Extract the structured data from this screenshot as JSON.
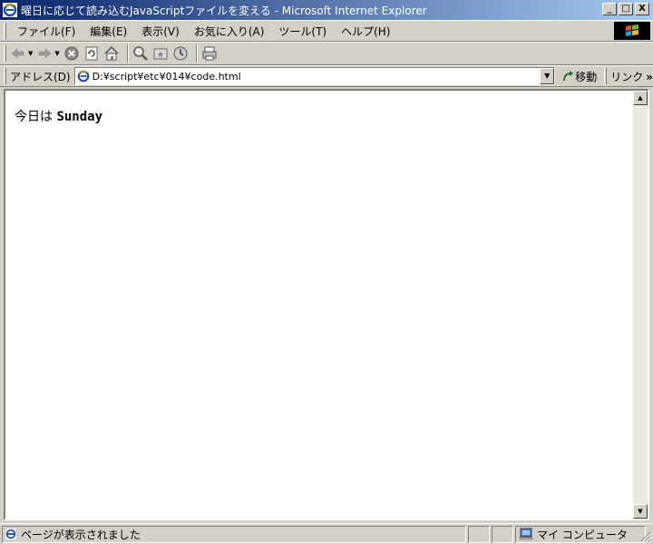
{
  "window": {
    "title": "曜日に応じて読み込むJavaScriptファイルを変える - Microsoft Internet Explorer",
    "minimize": "_",
    "maximize": "□",
    "close": "X"
  },
  "menu": {
    "items": [
      "ファイル(F)",
      "編集(E)",
      "表示(V)",
      "お気に入り(A)",
      "ツール(T)",
      "ヘルプ(H)"
    ]
  },
  "toolbar": {
    "icons": [
      "back-icon",
      "forward-icon",
      "stop-icon",
      "refresh-icon",
      "home-icon",
      "search-icon",
      "favorites-icon",
      "history-icon",
      "print-icon"
    ]
  },
  "address": {
    "label": "アドレス(D)",
    "url": "D:¥script¥etc¥014¥code.html",
    "go_label": "移動",
    "links_label": "リンク",
    "links_chevron": "»"
  },
  "content": {
    "prefix": "今日は",
    "day": "Sunday"
  },
  "status": {
    "message": "ページが表示されました",
    "zone": "マイ コンピュータ"
  },
  "colors": {
    "titlebar_start": "#0a246a",
    "titlebar_end": "#a6caf0",
    "chrome": "#d4d0c8"
  }
}
